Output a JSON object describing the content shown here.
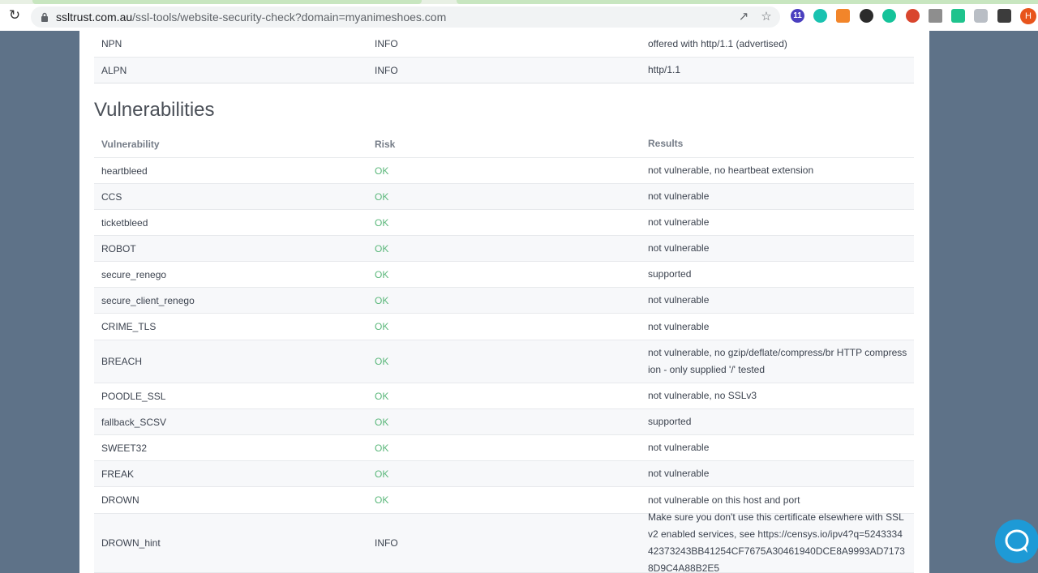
{
  "browser": {
    "url_host": "ssltrust.com.au",
    "url_path": "/ssl-tools/website-security-check?domain=myanimeshoes.com",
    "ext_badge": "11",
    "profile_initial": "H"
  },
  "icons": {
    "reload": "reload-icon",
    "lock": "lock-icon",
    "share": "share-icon",
    "star": "bookmark-star-icon",
    "extensions": "puzzle-icon",
    "chat": "chat-bubble-icon"
  },
  "colors": {
    "ok": "#5ab77a",
    "chat": "#1e9ad6"
  },
  "protocols": [
    {
      "name": "NPN",
      "risk": "INFO",
      "result": "offered with http/1.1 (advertised)"
    },
    {
      "name": "ALPN",
      "risk": "INFO",
      "result": "http/1.1"
    }
  ],
  "vulnerabilities": {
    "title": "Vulnerabilities",
    "headers": [
      "Vulnerability",
      "Risk",
      "Results"
    ],
    "rows": [
      {
        "name": "heartbleed",
        "risk": "OK",
        "result": "not vulnerable, no heartbeat extension"
      },
      {
        "name": "CCS",
        "risk": "OK",
        "result": "not vulnerable"
      },
      {
        "name": "ticketbleed",
        "risk": "OK",
        "result": "not vulnerable"
      },
      {
        "name": "ROBOT",
        "risk": "OK",
        "result": "not vulnerable"
      },
      {
        "name": "secure_renego",
        "risk": "OK",
        "result": "supported"
      },
      {
        "name": "secure_client_renego",
        "risk": "OK",
        "result": "not vulnerable"
      },
      {
        "name": "CRIME_TLS",
        "risk": "OK",
        "result": "not vulnerable"
      },
      {
        "name": "BREACH",
        "risk": "OK",
        "result": "not vulnerable, no gzip/deflate/compress/br HTTP compression - only supplied '/' tested"
      },
      {
        "name": "POODLE_SSL",
        "risk": "OK",
        "result": "not vulnerable, no SSLv3"
      },
      {
        "name": "fallback_SCSV",
        "risk": "OK",
        "result": "supported"
      },
      {
        "name": "SWEET32",
        "risk": "OK",
        "result": "not vulnerable"
      },
      {
        "name": "FREAK",
        "risk": "OK",
        "result": "not vulnerable"
      },
      {
        "name": "DROWN",
        "risk": "OK",
        "result": "not vulnerable on this host and port"
      },
      {
        "name": "DROWN_hint",
        "risk": "INFO",
        "result": "Make sure you don't use this certificate elsewhere with SSLv2 enabled services, see https://censys.io/ipv4?q=524333442373243BB41254CF7675A30461940DCE8A9993AD71738D9C4A88B2E5"
      }
    ]
  }
}
